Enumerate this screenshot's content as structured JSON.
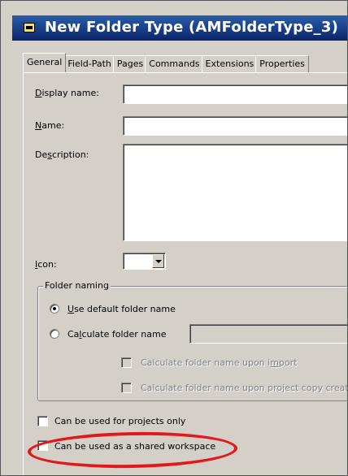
{
  "window": {
    "title": "New Folder Type (AMFolderType_3)"
  },
  "tabs": [
    {
      "label": "General",
      "active": true
    },
    {
      "label": "Field-Path"
    },
    {
      "label": "Pages"
    },
    {
      "label": "Commands"
    },
    {
      "label": "Extensions"
    },
    {
      "label": "Properties"
    }
  ],
  "general": {
    "display_name_label": "Display name:",
    "display_name_value": "",
    "name_label": "Name:",
    "name_value": "",
    "description_label": "Description:",
    "description_value": "",
    "icon_label": "Icon:"
  },
  "folder_naming": {
    "legend": "Folder naming",
    "use_default_label": "Use default folder name",
    "use_default_checked": true,
    "calculate_label": "Calculate folder name",
    "calculate_checked": false,
    "calculate_value": "",
    "on_import_label": "Calculate folder name upon import",
    "on_project_copy_label": "Calculate folder name upon project copy creation"
  },
  "options": {
    "projects_only_label": "Can be used for projects only",
    "shared_workspace_label": "Can be used as a shared workspace"
  },
  "annotation": {
    "color": "#e2191c"
  }
}
